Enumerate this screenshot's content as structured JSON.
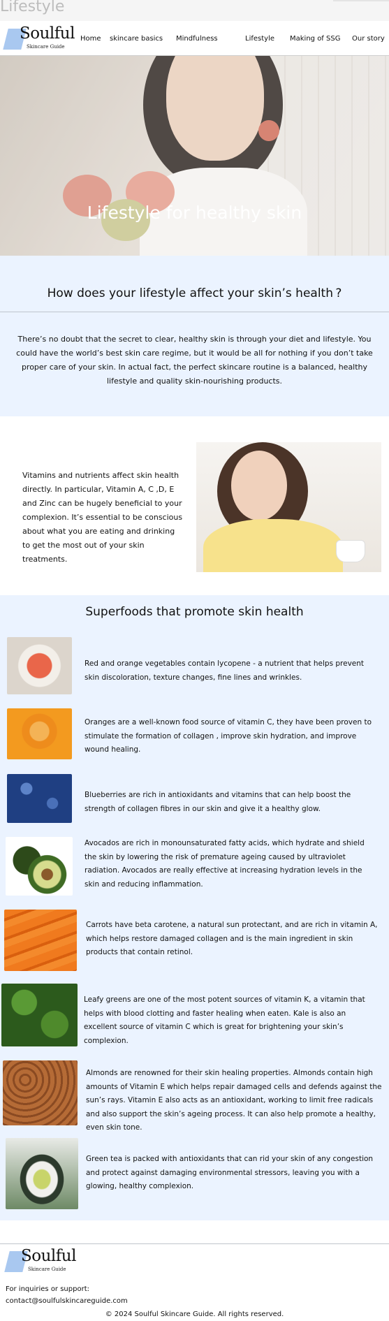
{
  "tab": {
    "title": "Lifestyle"
  },
  "brand": {
    "name": "Soulful",
    "tagline": "Skincare Guide"
  },
  "nav": {
    "items": [
      {
        "label": "Home"
      },
      {
        "label": "skincare basics"
      },
      {
        "label": "Mindfulness"
      },
      {
        "label": "Lifestyle"
      },
      {
        "label": "Making of SSG"
      },
      {
        "label": "Our story"
      }
    ]
  },
  "hero": {
    "title": "Lifestyle for healthy skin"
  },
  "intro": {
    "heading": "How does your lifestyle affect your skin’s health ?",
    "body": "There’s no doubt that the secret to clear, healthy skin is through your diet and lifestyle. You could have the world’s best skin care regime, but it would be all for nothing if you don’t take proper care of your skin. In actual fact, the perfect skincare routine is a balanced, healthy lifestyle and quality skin-nourishing products."
  },
  "vitamins": {
    "body": "Vitamins and nutrients affect skin health directly. In particular, Vitamin A, C ,D, E and Zinc can be hugely beneficial to your complexion. It’s essential to be conscious about what you are eating and drinking to get the most out of your skin treatments."
  },
  "superfoods": {
    "heading": "Superfoods that promote skin health",
    "items": [
      {
        "image": "sweet-potato",
        "text": "Red and orange vegetables contain lycopene - a nutrient that helps prevent skin discoloration, texture changes, fine lines and wrinkles."
      },
      {
        "image": "oranges",
        "text": "Oranges are a well-known food source of vitamin C, they have been proven to stimulate the formation of collagen , improve skin hydration, and improve wound healing."
      },
      {
        "image": "blueberries",
        "text": "Blueberries are rich in antioxidants and vitamins that can help boost the strength of collagen fibres in our skin and give it a healthy glow."
      },
      {
        "image": "avocados",
        "text": "Avocados are rich in monounsaturated fatty acids, which hydrate and shield the skin by lowering the risk of premature ageing caused by ultraviolet radiation. Avocados are really effective at increasing hydration levels in the skin and reducing inflammation."
      },
      {
        "image": "carrots",
        "text": "Carrots have beta carotene, a natural sun protectant, and are rich in vitamin A, which helps restore damaged collagen and is the main ingredient in skin products that contain retinol."
      },
      {
        "image": "leafy-greens",
        "text": "Leafy greens are one of the most potent sources of vitamin K, a vitamin that helps with blood clotting and faster healing when eaten. Kale is also an excellent source of vitamin C which is great for brightening your skin’s complexion."
      },
      {
        "image": "almonds",
        "text": "Almonds are renowned for their skin healing properties. Almonds contain high amounts of Vitamin E which helps repair damaged cells and defends against the sun’s rays. Vitamin E also acts as an antioxidant, working to limit free radicals and also support the skin’s ageing process. It can also help promote a healthy, even skin tone."
      },
      {
        "image": "green-tea",
        "text": "Green tea is packed with antioxidants that can rid your skin of any congestion and protect against damaging environmental stressors, leaving you with a glowing, healthy complexion."
      }
    ]
  },
  "footer": {
    "inquiries": "For inquiries or support:",
    "email": "contact@soulfulskincareguide.com",
    "copyright": "© 2024 Soulful Skincare Guide. All rights reserved."
  },
  "colors": {
    "section_bg": "#ebf3ff",
    "logo_accent": "#a9c8f0"
  }
}
